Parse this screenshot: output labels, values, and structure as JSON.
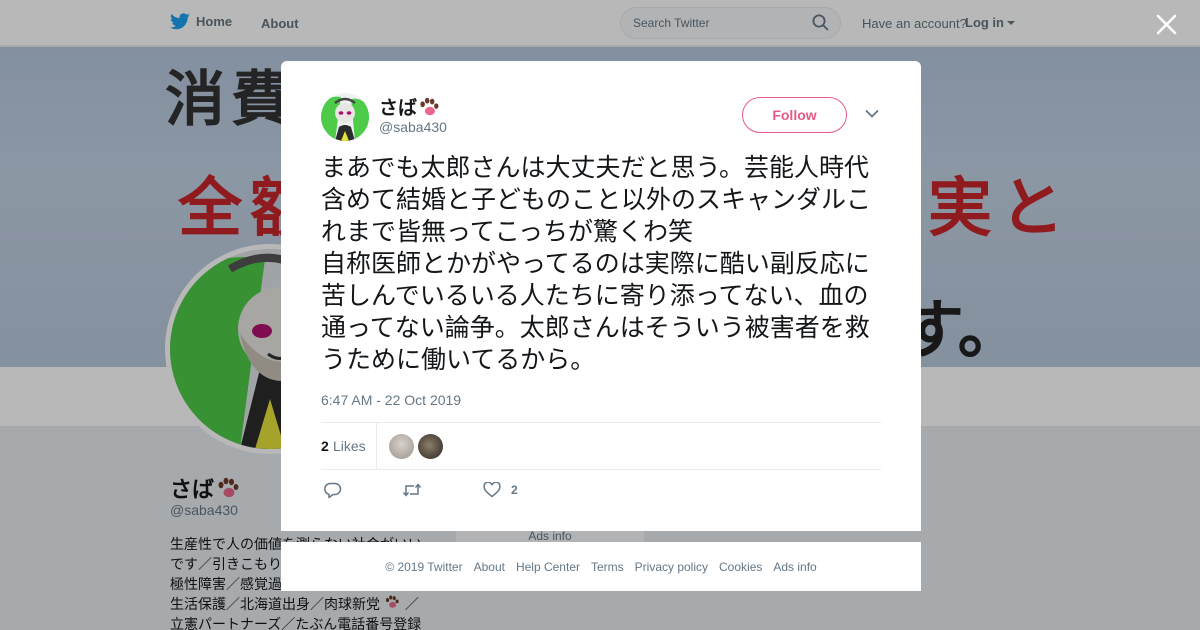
{
  "nav": {
    "home_label": "Home",
    "about_label": "About",
    "search_placeholder": "Search Twitter",
    "account_prompt": "Have an account?",
    "login_label": "Log in"
  },
  "background_profile": {
    "banner_lines": [
      "消費税",
      "全額",
      "実と",
      "す。"
    ],
    "name": "さば",
    "handle": "@saba430",
    "bio_lines": [
      "生産性で人の価値を測らない社会がいい",
      "です／引きこもり",
      "極性障害／感覚過",
      "生活保護／北海道出身／肉球新党",
      "立憲パートナーズ／たぶん電話番号登録"
    ],
    "ads_info": "Ads info"
  },
  "tweet": {
    "author_name": "さば",
    "author_handle": "@saba430",
    "follow_label": "Follow",
    "text": "まあでも太郎さんは大丈夫だと思う。芸能人時代含めて結婚と子どものこと以外のスキャンダルこれまで皆無ってこっちが驚くわ笑\n自称医師とかがやってるのは実際に酷い副反応に苦しんでいるいる人たちに寄り添ってない、血の通ってない論争。太郎さんはそういう被害者を救うために働いてるから。",
    "timestamp": "6:47 AM - 22 Oct 2019",
    "likes_count": "2",
    "likes_label": "Likes",
    "like_action_count": "2"
  },
  "footer": {
    "copyright": "© 2019 Twitter",
    "links": [
      "About",
      "Help Center",
      "Terms",
      "Privacy policy",
      "Cookies",
      "Ads info"
    ]
  },
  "colors": {
    "twitter_blue": "#1da1f2",
    "follow_pink": "#e0245e",
    "secondary_text": "#657786",
    "banner_red": "#c8262c"
  },
  "icons": [
    "twitter-bird-icon",
    "search-icon",
    "caret-down-icon",
    "close-icon",
    "paw-emoji-icon",
    "reply-icon",
    "retweet-icon",
    "heart-icon"
  ]
}
